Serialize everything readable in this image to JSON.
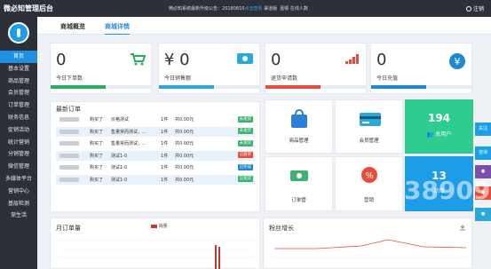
{
  "header": {
    "title": "微必知管理后台",
    "notice_prefix": "微必知系统最新升级公告：",
    "notice_version": "20180810",
    "notice_link1": "点击查看",
    "notice_link2": "渠道版",
    "greeting": "嘉顿 在线人数",
    "logout": "注销"
  },
  "sidebar": {
    "items": [
      "首页",
      "基本设置",
      "商品管理",
      "会员管理",
      "订单管理",
      "财务信息",
      "促销活动",
      "统计营销",
      "分销管理",
      "微信管理",
      "多媒体平台",
      "营销中心",
      "基层检测",
      "渐生活"
    ]
  },
  "tabs": [
    "商城概览",
    "商城详情"
  ],
  "stats": [
    {
      "value": "0",
      "label": "今日下单数",
      "color": "#27ae60",
      "icon": "cart-icon",
      "progress": 0.55
    },
    {
      "value": "¥ 0",
      "label": "今日销售额",
      "color": "#2aa9d8",
      "icon": "money-icon",
      "progress": 0.55
    },
    {
      "value": "0",
      "label": "退货申请数",
      "color": "#e74c3c",
      "icon": "signal-icon",
      "progress": 0.55
    },
    {
      "value": "0",
      "label": "今日充值",
      "color": "#1e88d0",
      "icon": "yuan-icon",
      "progress": 0.55
    }
  ],
  "orders": {
    "title": "最新订单",
    "rows": [
      {
        "action": "购买了",
        "product": "价格测试",
        "qty": "1件",
        "price": "共0.00元",
        "status": "未发货",
        "color": "#3cb371"
      },
      {
        "action": "购买了",
        "product": "售量常而测试，...",
        "qty": "1件",
        "price": "共0.00元",
        "status": "未发货",
        "color": "#3cb371"
      },
      {
        "action": "购买了",
        "product": "售量常而测试，...",
        "qty": "1件",
        "price": "共0.00元",
        "status": "未发货",
        "color": "#3cb371"
      },
      {
        "action": "购买了",
        "product": "测试1-0",
        "qty": "1件",
        "price": "共0.00元",
        "status": "已退单",
        "color": "#e74c3c"
      },
      {
        "action": "购买了",
        "product": "测试1-0",
        "qty": "1件",
        "price": "共0.00元",
        "status": "已完成",
        "color": "#1e88d0"
      },
      {
        "action": "购买了",
        "product": "测试1-0",
        "qty": "1件",
        "price": "共0.00元",
        "status": "已发货",
        "color": "#3cb371"
      }
    ]
  },
  "tiles": {
    "goods": "商品管理",
    "members": "会员管理",
    "users_count": "194",
    "users_label": "总用户",
    "shop_label": "订单管",
    "promo_label": "营销",
    "blue2_value": "13",
    "blue2_label": "新增"
  },
  "charts": {
    "monthly_title": "月订单量",
    "monthly_legend": "销量",
    "fans_title": "粉丝增长"
  },
  "side_tabs": [
    "关注",
    "咨询"
  ],
  "watermark": "38909"
}
